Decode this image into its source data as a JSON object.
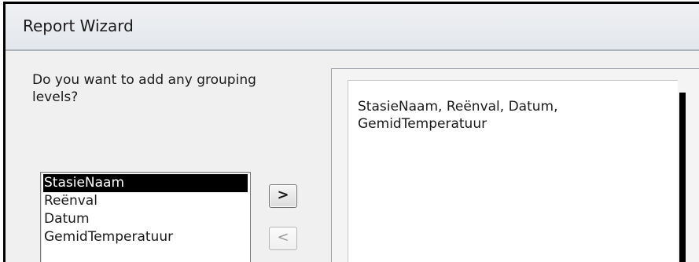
{
  "window": {
    "title": "Report Wizard"
  },
  "wizard": {
    "question": "Do you want to add any grouping levels?",
    "fields": [
      "StasieNaam",
      "Reënval",
      "Datum",
      "GemidTemperatuur"
    ],
    "selected_field": "StasieNaam",
    "add_button_label": ">",
    "remove_button_label": "<",
    "preview_text": "StasieNaam, Reënval, Datum, GemidTemperatuur"
  }
}
